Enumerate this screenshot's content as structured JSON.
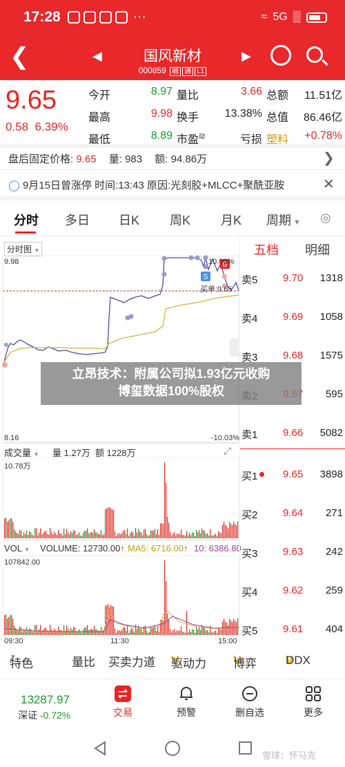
{
  "status": {
    "time": "17:28",
    "signal": "5G",
    "dots": "···"
  },
  "header": {
    "title": "国风新材",
    "code": "000859",
    "tag1": "融",
    "tag2": "通",
    "tag3": "L1"
  },
  "quote": {
    "price": "9.65",
    "change": "0.58",
    "change_pct": "6.39%",
    "rows": [
      [
        "今开",
        "8.97",
        "量比",
        "3.66",
        "总额",
        "11.51亿"
      ],
      [
        "最高",
        "9.98",
        "换手",
        "13.38%",
        "总值",
        "86.46亿"
      ],
      [
        "最低",
        "8.89",
        "市盈",
        "动",
        "亏损",
        "塑料",
        "+0.78%"
      ]
    ]
  },
  "after_hours": {
    "label": "盘后固定价格:",
    "price": "9.65",
    "vol_label": "量:",
    "vol": "983",
    "amt_label": "额:",
    "amt": "94.86万"
  },
  "note": {
    "text": "9月15日曾涨停  时间:13:43  原因:光刻胶+MLCC+聚酰亚胺"
  },
  "tabs": [
    "分时",
    "多日",
    "日K",
    "周K",
    "月K",
    "周期"
  ],
  "intraday": {
    "selector": "分时图",
    "y_high": "9.98",
    "y_low": "8.16",
    "pct_high": "10.00%",
    "pct_low": "-10.03%",
    "label_s": "S",
    "label_b": "B",
    "sell_note": "买单:9.65"
  },
  "volume_panel": {
    "selector": "成交量",
    "vol_label": "量 1.27万",
    "amt_label": "额 1228万",
    "max": "10.78万"
  },
  "vol_panel": {
    "selector": "VOL",
    "volume": "VOLUME: 12730.00",
    "ma5": "MA5: 6716.00",
    "ma10": "10: 6386.80",
    "max": "107842.00"
  },
  "time_axis": [
    "09:30",
    "11:30",
    "15:00"
  ],
  "orderbook": {
    "tab1": "五档",
    "tab2": "明细",
    "sell": [
      {
        "label": "卖5",
        "price": "9.70",
        "vol": "1318"
      },
      {
        "label": "卖4",
        "price": "9.69",
        "vol": "1058"
      },
      {
        "label": "卖3",
        "price": "9.68",
        "vol": "1575"
      },
      {
        "label": "卖2",
        "price": "9.67",
        "vol": "595"
      },
      {
        "label": "卖1",
        "price": "9.66",
        "vol": "5082"
      }
    ],
    "buy": [
      {
        "label": "买1",
        "price": "9.65",
        "vol": "3898"
      },
      {
        "label": "买2",
        "price": "9.64",
        "vol": "271"
      },
      {
        "label": "买3",
        "price": "9.63",
        "vol": "242"
      },
      {
        "label": "买4",
        "price": "9.62",
        "vol": "259"
      },
      {
        "label": "买5",
        "price": "9.61",
        "vol": "404"
      }
    ]
  },
  "news": {
    "line1": "立昂技术：附属公司拟1.93亿元收购",
    "line2": "博玺数据100%股权"
  },
  "indicators": [
    "特色",
    "量比",
    "买卖力道",
    "驱动力",
    "博弈",
    "DDX"
  ],
  "bottom": {
    "index_value": "13287.97",
    "index_name": "深证",
    "index_chg": "-0.72%",
    "items": [
      "交易",
      "预警",
      "删自选",
      "更多"
    ]
  },
  "watermark": "雪球：怀马克",
  "colors": {
    "header": "#e8282b",
    "up": "#e22222",
    "down": "#1a9a2a",
    "price_line": "#4a4aa8",
    "avg_line": "#d8b040"
  }
}
